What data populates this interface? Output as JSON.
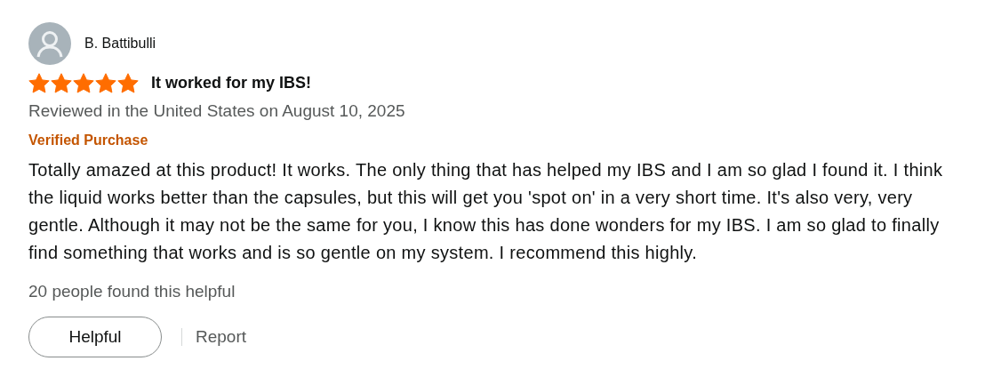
{
  "reviewer": {
    "name": "B. Battibulli"
  },
  "rating": {
    "stars": 5
  },
  "title": "It worked for my IBS!",
  "meta": "Reviewed in the United States on August 10, 2025",
  "badge": "Verified Purchase",
  "body": "Totally amazed at this product! It works. The only thing that has helped my IBS and I am so glad I found it. I think the liquid works better than the capsules, but this will get you 'spot on' in a very short time. It's also very, very gentle. Although it may not be the same for you, I know this has done wonders for my IBS. I am so glad to finally find something that works and is so gentle on my system. I recommend this highly.",
  "helpful_count": "20 people found this helpful",
  "actions": [
    {
      "kind": "button",
      "label": "Helpful"
    },
    {
      "kind": "link",
      "label": "Report"
    }
  ]
}
